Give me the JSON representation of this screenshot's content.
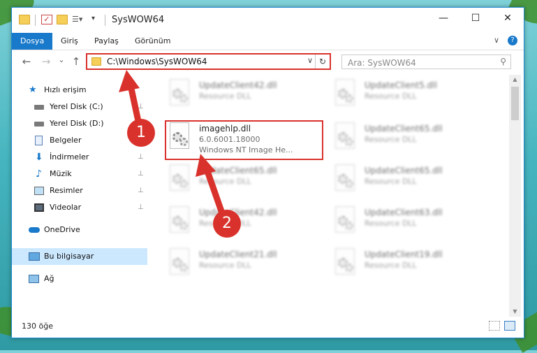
{
  "window": {
    "title": "SysWOW64",
    "controls": {
      "minimize": "—",
      "maximize": "☐",
      "close": "✕"
    }
  },
  "ribbon": {
    "tabs": [
      "Dosya",
      "Giriş",
      "Paylaş",
      "Görünüm"
    ],
    "active_tab": "Dosya",
    "collapse": "∨",
    "help": "?"
  },
  "address_bar": {
    "path": "C:\\Windows\\SysWOW64",
    "dropdown": "∨",
    "refresh": "↻"
  },
  "nav_buttons": {
    "back": "←",
    "forward": "→",
    "recent": "⌄",
    "up": "↑"
  },
  "search": {
    "placeholder": "Ara: SysWOW64",
    "icon": "search-icon"
  },
  "sidebar": {
    "items": [
      {
        "label": "Hızlı erişim",
        "icon": "star-icon",
        "pinned": false
      },
      {
        "label": "Yerel Disk (C:)",
        "icon": "drive-icon",
        "pinned": true
      },
      {
        "label": "Yerel Disk (D:)",
        "icon": "drive-icon",
        "pinned": true
      },
      {
        "label": "Belgeler",
        "icon": "documents-icon",
        "pinned": true
      },
      {
        "label": "İndirmeler",
        "icon": "download-icon",
        "pinned": true
      },
      {
        "label": "Müzik",
        "icon": "music-icon",
        "pinned": true
      },
      {
        "label": "Resimler",
        "icon": "pictures-icon",
        "pinned": true
      },
      {
        "label": "Videolar",
        "icon": "video-icon",
        "pinned": true
      },
      {
        "label": "OneDrive",
        "icon": "cloud-icon",
        "pinned": false
      },
      {
        "label": "Bu bilgisayar",
        "icon": "computer-icon",
        "pinned": false,
        "selected": true
      },
      {
        "label": "Ağ",
        "icon": "network-icon",
        "pinned": false
      }
    ],
    "pin_glyph": "📌"
  },
  "files": [
    {
      "name": "UpdateClient42.dll",
      "desc": "Resource DLL",
      "blurred": true
    },
    {
      "name": "UpdateClient5.dll",
      "desc": "Resource DLL",
      "blurred": true
    },
    {
      "name": "imagehlp.dll",
      "desc": "6.0.6001.18000",
      "desc2": "Windows NT Image He...",
      "blurred": false,
      "highlighted": true
    },
    {
      "name": "UpdateClient65.dll",
      "desc": "Resource DLL",
      "blurred": true
    },
    {
      "name": "UpdateClient65.dll",
      "desc": "Resource DLL",
      "blurred": true
    },
    {
      "name": "UpdateClient65.dll",
      "desc": "Resource DLL",
      "blurred": true
    },
    {
      "name": "UpdateClient42.dll",
      "desc": "Resource DLL",
      "blurred": true
    },
    {
      "name": "UpdateClient63.dll",
      "desc": "Resource DLL",
      "blurred": true
    },
    {
      "name": "UpdateClient21.dll",
      "desc": "Resource DLL",
      "blurred": true
    },
    {
      "name": "UpdateClient19.dll",
      "desc": "Resource DLL",
      "blurred": true
    }
  ],
  "status": {
    "item_count": "130 öğe"
  },
  "annotations": {
    "marker1": "1",
    "marker2": "2",
    "color": "#d9322c"
  },
  "colors": {
    "accent": "#1979ca",
    "highlight": "#d9322c",
    "selection": "#cce8ff"
  }
}
